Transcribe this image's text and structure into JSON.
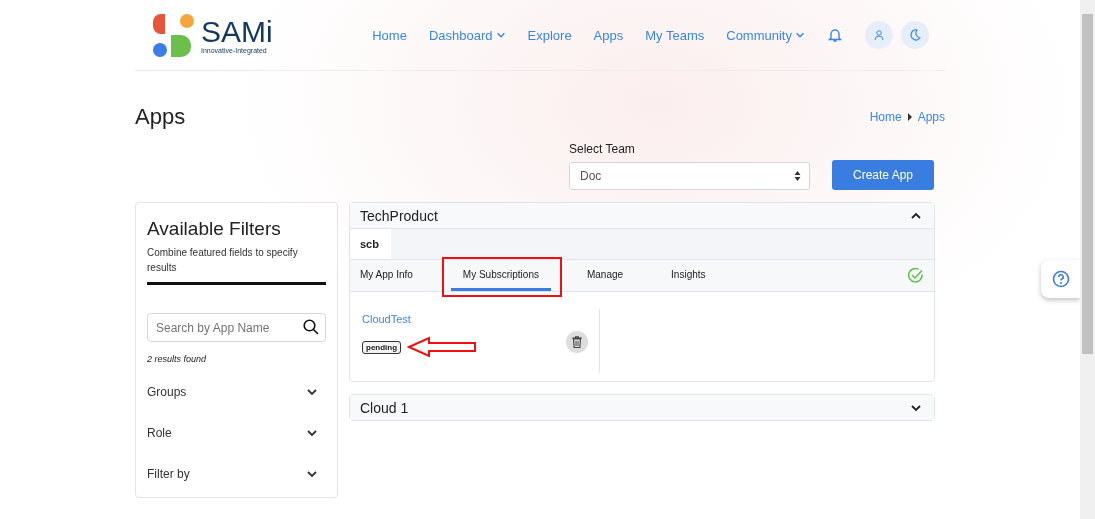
{
  "header": {
    "brand": "SAMi",
    "tagline": "Innovative-Integrated",
    "nav": [
      {
        "label": "Home",
        "dropdown": false
      },
      {
        "label": "Dashboard",
        "dropdown": true
      },
      {
        "label": "Explore",
        "dropdown": false
      },
      {
        "label": "Apps",
        "dropdown": false
      },
      {
        "label": "My Teams",
        "dropdown": false
      },
      {
        "label": "Community",
        "dropdown": true
      }
    ]
  },
  "page_title": "Apps",
  "breadcrumb": [
    "Home",
    "Apps"
  ],
  "team_select": {
    "label": "Select Team",
    "value": "Doc"
  },
  "create_button": "Create App",
  "filters": {
    "title": "Available Filters",
    "subtitle": "Combine featured fields to specify results",
    "search": {
      "placeholder": "Search by App Name"
    },
    "results": "2 results found",
    "groups": [
      {
        "label": "Groups",
        "expanded": false
      },
      {
        "label": "Role",
        "expanded": false
      },
      {
        "label": "Filter by",
        "expanded": false
      }
    ]
  },
  "products": [
    {
      "title": "TechProduct",
      "expanded": true,
      "team": "scb",
      "verified": true,
      "tabs": [
        {
          "label": "My App Info",
          "selected": false
        },
        {
          "label": "My Subscriptions",
          "selected": true
        },
        {
          "label": "Manage",
          "selected": false
        },
        {
          "label": "Insights",
          "selected": false
        }
      ],
      "subscriptions": [
        {
          "name": "CloudTest",
          "status": "pending"
        }
      ]
    },
    {
      "title": "Cloud 1",
      "expanded": false
    }
  ]
}
